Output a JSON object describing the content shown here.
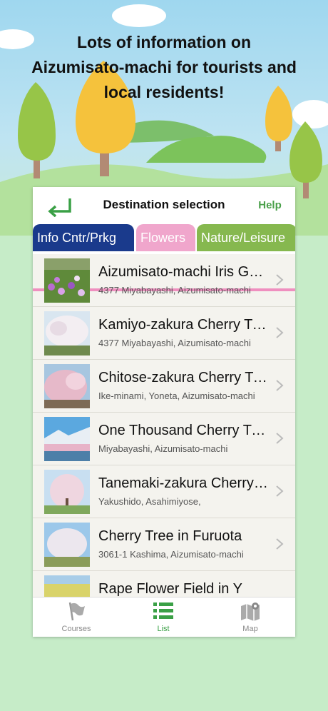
{
  "headline": {
    "line1": "Lots of information on",
    "line2": "Aizumisato-machi for tourists and",
    "line3": "local residents!"
  },
  "nav": {
    "title": "Destination selection",
    "help_label": "Help",
    "back_icon": "back-arrow-icon"
  },
  "tabs": [
    {
      "label": "Info Cntr/Prkg",
      "color": "#1a3a8c"
    },
    {
      "label": "Flowers",
      "color": "#f0a6cc",
      "selected": true
    },
    {
      "label": "Nature/Leisure",
      "color": "#86b84f"
    }
  ],
  "list": [
    {
      "title": "Aizumisato-machi Iris Garden",
      "subtitle": "4377 Miyabayashi, Aizumisato-machi"
    },
    {
      "title": "Kamiyo-zakura Cherry Tree",
      "subtitle": "4377 Miyabayashi, Aizumisato-machi"
    },
    {
      "title": "Chitose-zakura Cherry Tree",
      "subtitle": "Ike-minami, Yoneta, Aizumisato-machi"
    },
    {
      "title": "One Thousand Cherry Trees",
      "subtitle": "Miyabayashi, Aizumisato-machi"
    },
    {
      "title": "Tanemaki-zakura Cherry Tree",
      "subtitle": "Yakushido, Asahimiyose,"
    },
    {
      "title": "Cherry Tree in Furuota",
      "subtitle": "3061-1 Kashima, Aizumisato-machi"
    },
    {
      "title": "Rape Flower Field in Y",
      "subtitle": ""
    }
  ],
  "tabbar": [
    {
      "label": "Courses",
      "icon": "flag-icon",
      "color": "#888888"
    },
    {
      "label": "List",
      "icon": "list-icon",
      "color": "#3aa046",
      "selected": true
    },
    {
      "label": "Map",
      "icon": "map-icon",
      "color": "#888888"
    }
  ]
}
